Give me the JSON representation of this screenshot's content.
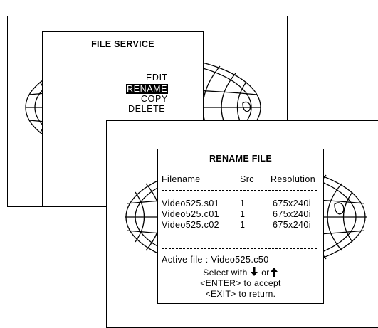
{
  "screen1": {
    "title": "FILE SERVICE",
    "items": [
      {
        "label": "EDIT",
        "selected": false
      },
      {
        "label": "RENAME",
        "selected": true
      },
      {
        "label": "COPY",
        "selected": false
      },
      {
        "label": "DELETE",
        "selected": false
      }
    ]
  },
  "screen2": {
    "title": "RENAME FILE",
    "columns": [
      "Filename",
      "Src",
      "Resolution"
    ],
    "rows": [
      {
        "filename": "Video525.s01",
        "src": "1",
        "resolution": "675x240i"
      },
      {
        "filename": "Video525.c01",
        "src": "1",
        "resolution": "675x240i"
      },
      {
        "filename": "Video525.c02",
        "src": "1",
        "resolution": "675x240i"
      }
    ],
    "active_label": "Active file : ",
    "active_value": "Video525.c50",
    "instructions": {
      "select_prefix": "Select with",
      "or_text": "or",
      "enter_line": "<ENTER> to accept",
      "exit_line": "<EXIT> to return."
    },
    "icons": [
      "arrow-down-icon",
      "arrow-up-icon"
    ]
  }
}
